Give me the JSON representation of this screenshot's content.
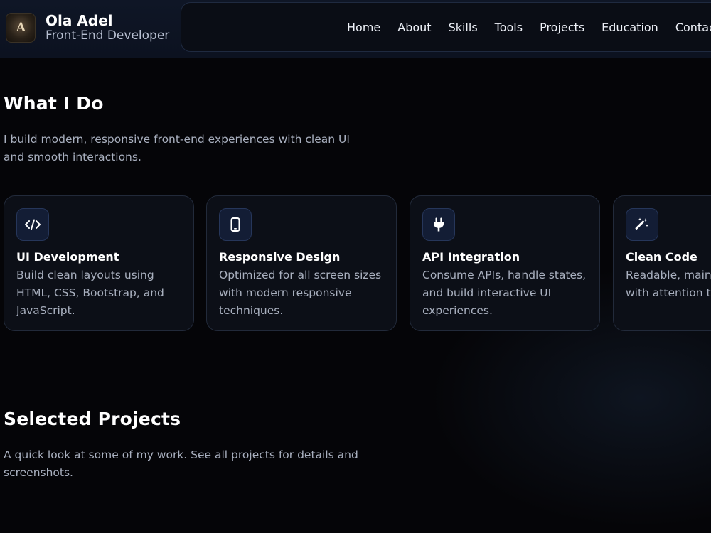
{
  "header": {
    "logo_text": "A",
    "name": "Ola Adel",
    "role": "Front-End Developer",
    "nav": [
      "Home",
      "About",
      "Skills",
      "Tools",
      "Projects",
      "Education",
      "Contact"
    ]
  },
  "what_i_do": {
    "title": "What I Do",
    "description": "I build modern, responsive front-end experiences with clean UI and smooth interactions.",
    "cards": [
      {
        "icon": "code-icon",
        "title": "UI Development",
        "text": "Build clean layouts using HTML, CSS, Bootstrap, and JavaScript."
      },
      {
        "icon": "mobile-icon",
        "title": "Responsive Design",
        "text": "Optimized for all screen sizes with modern responsive techniques."
      },
      {
        "icon": "plug-icon",
        "title": "API Integration",
        "text": "Consume APIs, handle states, and build interactive UI experiences."
      },
      {
        "icon": "magic-wand-icon",
        "title": "Clean Code",
        "text_line1": "Readable, maintainable",
        "text_line2": "with attention to"
      }
    ]
  },
  "projects": {
    "title": "Selected Projects",
    "description": "A quick look at some of my work. See all projects for details and screenshots."
  },
  "colors": {
    "background": "#050508",
    "header": "#0f1626",
    "card": "#0c0f17",
    "icon_bg": "#131d35",
    "muted_text": "#a9b0bf"
  }
}
